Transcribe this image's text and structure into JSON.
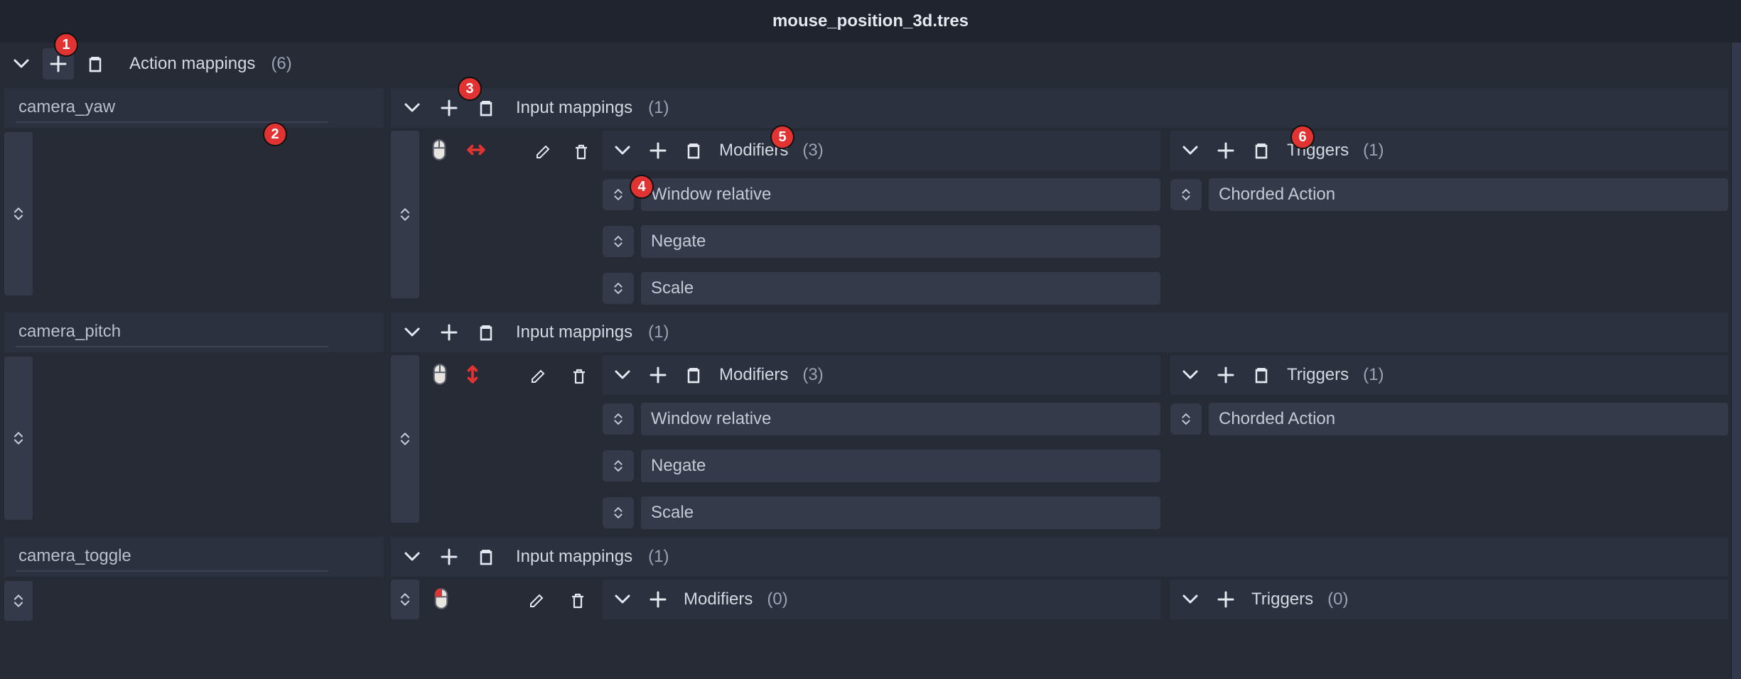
{
  "title": "mouse_position_3d.tres",
  "labels": {
    "action_mappings": "Action mappings",
    "input_mappings": "Input mappings",
    "modifiers": "Modifiers",
    "triggers": "Triggers"
  },
  "counts": {
    "action_mappings": "(6)"
  },
  "actions": [
    {
      "name": "camera_yaw",
      "input_count": "(1)",
      "modifiers_count": "(3)",
      "triggers_count": "(1)",
      "modifiers": [
        "Window relative",
        "Negate",
        "Scale"
      ],
      "triggers": [
        "Chorded Action"
      ]
    },
    {
      "name": "camera_pitch",
      "input_count": "(1)",
      "modifiers_count": "(3)",
      "triggers_count": "(1)",
      "modifiers": [
        "Window relative",
        "Negate",
        "Scale"
      ],
      "triggers": [
        "Chorded Action"
      ]
    },
    {
      "name": "camera_toggle",
      "input_count": "(1)",
      "modifiers_count": "(0)",
      "triggers_count": "(0)",
      "modifiers": [],
      "triggers": []
    }
  ],
  "callouts": [
    "1",
    "2",
    "3",
    "4",
    "5",
    "6"
  ]
}
